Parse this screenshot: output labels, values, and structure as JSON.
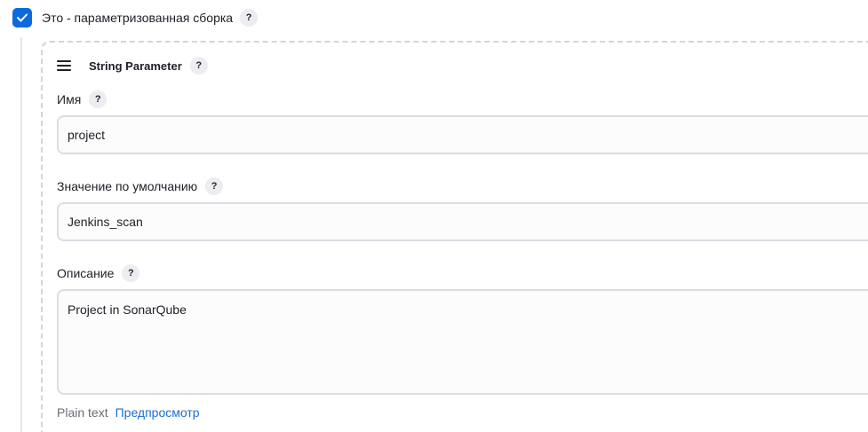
{
  "parameterized_build": {
    "checked": true,
    "label": "Это - параметризованная сборка",
    "help": "?"
  },
  "string_parameter": {
    "title": "String Parameter",
    "help": "?",
    "name_field": {
      "label": "Имя",
      "help": "?",
      "value": "project"
    },
    "default_value_field": {
      "label": "Значение по умолчанию",
      "help": "?",
      "value": "Jenkins_scan"
    },
    "description_field": {
      "label": "Описание",
      "help": "?",
      "value": "Project in SonarQube"
    },
    "format": {
      "plain_text": "Plain text",
      "preview_link": "Предпросмотр"
    }
  },
  "colors": {
    "accent": "#0b6bde",
    "link": "#1a6fd1",
    "border": "#dcdce4",
    "dashed_border": "#d4d4dc"
  },
  "icons": {
    "checkbox": "checkmark-icon",
    "drag_handle": "drag-handle-icon",
    "help": "question-mark-icon"
  }
}
